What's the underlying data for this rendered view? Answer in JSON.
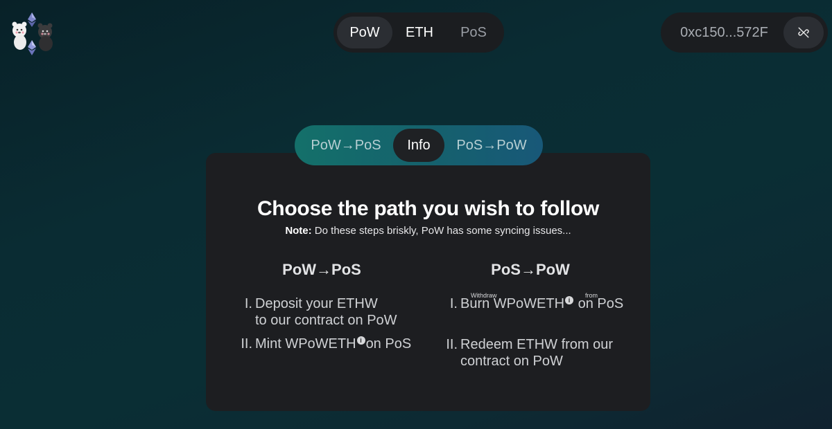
{
  "network_switch": {
    "options": [
      "PoW",
      "ETH",
      "PoS"
    ],
    "active": "PoW"
  },
  "wallet": {
    "address": "0xc150...572F",
    "disconnect_icon": "unlink-icon"
  },
  "bridge_tabs": {
    "tabs": [
      "PoW→PoS",
      "Info",
      "PoS→PoW"
    ],
    "active": "Info"
  },
  "info": {
    "title": "Choose the path you wish to follow",
    "note_label": "Note:",
    "note_text": " Do these steps briskly, PoW has some syncing issues...",
    "left": {
      "heading": "PoW→PoS",
      "steps": [
        {
          "num": "I.",
          "line1": "Deposit your ETHW",
          "line2": "to our contract on PoW"
        },
        {
          "num": "II.",
          "line1_a": "Mint WPoWETH",
          "line1_b": "on PoS"
        }
      ]
    },
    "right": {
      "heading": "PoS→PoW",
      "steps": [
        {
          "num": "I.",
          "line1_a": "Burn WPoWETH",
          "line1_b": " on PoS",
          "label_withdraw": "Withdraw",
          "label_from": "from"
        },
        {
          "num": "II.",
          "line1": "Redeem ETHW from our",
          "line2": "contract on PoW"
        }
      ]
    },
    "info_icon_glyph": "i"
  },
  "colors": {
    "card_bg": "#1d1e21",
    "tabs_gradient_start": "#14706a",
    "tabs_gradient_end": "#185878"
  }
}
